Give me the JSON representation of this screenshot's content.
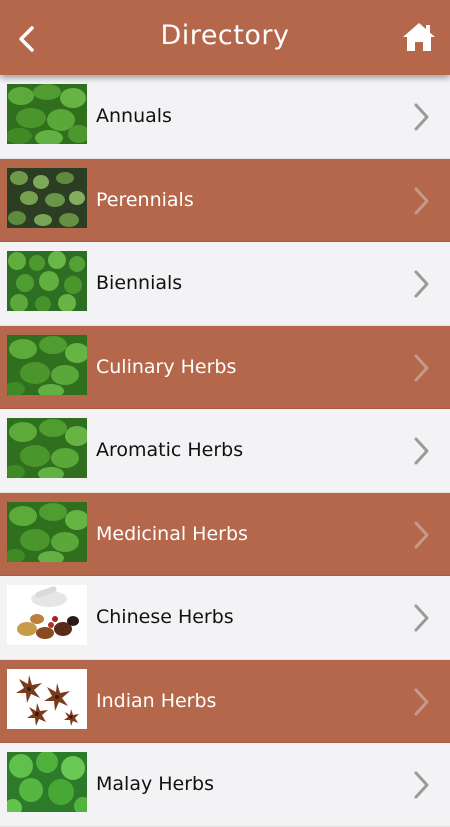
{
  "header": {
    "title": "Directory",
    "back_icon": "chevron-left-icon",
    "home_icon": "home-icon"
  },
  "colors": {
    "accent": "#b5674b",
    "row_light": "#f3f3f5",
    "text_dark": "#111111",
    "text_light": "#ffffff",
    "chevron": "#9a9a9a"
  },
  "items": [
    {
      "label": "Annuals",
      "thumb": "green-herb-leaves"
    },
    {
      "label": "Perennials",
      "thumb": "green-herb-leaves"
    },
    {
      "label": "Biennials",
      "thumb": "green-herb-leaves"
    },
    {
      "label": "Culinary Herbs",
      "thumb": "green-herb-leaves"
    },
    {
      "label": "Aromatic Herbs",
      "thumb": "green-herb-leaves"
    },
    {
      "label": "Medicinal Herbs",
      "thumb": "green-herb-leaves"
    },
    {
      "label": "Chinese Herbs",
      "thumb": "mortar-and-spices"
    },
    {
      "label": "Indian Herbs",
      "thumb": "star-anise"
    },
    {
      "label": "Malay Herbs",
      "thumb": "green-round-leaves"
    }
  ]
}
